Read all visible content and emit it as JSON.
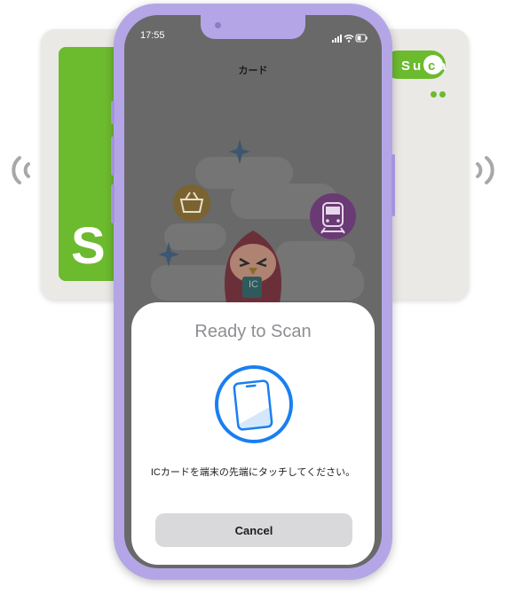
{
  "card": {
    "letter": "S",
    "brand": "Suica",
    "brand_chars": [
      "S",
      "u",
      "i",
      "c",
      "a"
    ],
    "colors": {
      "green": "#6cba2e",
      "base": "#ebe9e6"
    }
  },
  "status_bar": {
    "time": "17:55",
    "icons": [
      "signal-icon",
      "wifi-icon",
      "battery-icon"
    ]
  },
  "nav": {
    "title": "カード"
  },
  "illustration": {
    "badge_text": "IC",
    "icons": [
      "basket-icon",
      "train-icon",
      "sparkle-icon",
      "penguin-icon"
    ]
  },
  "scan_sheet": {
    "title": "Ready to Scan",
    "message": "ICカードを端末の先端にタッチしてください。",
    "cancel_label": "Cancel",
    "accent": "#1a7ff0"
  },
  "colors": {
    "phone_frame": "#b4a6e6",
    "screen_dim": "#696969"
  }
}
